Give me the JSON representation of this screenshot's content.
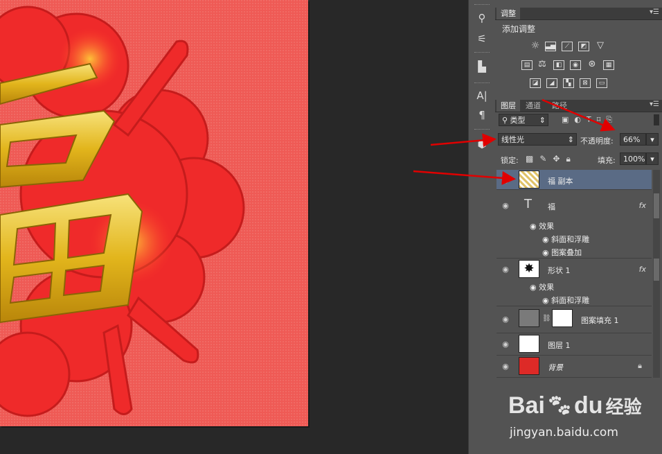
{
  "canvas_art": {
    "glyph_fragment": "福"
  },
  "adjustments_panel": {
    "tab": "调整",
    "title": "添加调整",
    "icons_row1": [
      "brightness-contrast-icon",
      "levels-icon",
      "curves-icon",
      "exposure-icon",
      "vibrance-icon"
    ],
    "icons_row2": [
      "hue-saturation-icon",
      "color-balance-icon",
      "black-white-icon",
      "photo-filter-icon",
      "channel-mixer-icon",
      "color-lookup-icon"
    ],
    "icons_row3": [
      "invert-icon",
      "posterize-icon",
      "threshold-icon",
      "selective-color-icon",
      "gradient-map-icon"
    ]
  },
  "layers_panel": {
    "tabs": [
      "图层",
      "通道",
      "路径"
    ],
    "filter_kind": "类型",
    "blend_mode": "线性光",
    "opacity_label": "不透明度:",
    "opacity_value": "66%",
    "lock_label": "锁定:",
    "fill_label": "填充:",
    "fill_value": "100%",
    "layers": [
      {
        "name": "福 副本",
        "selected": true
      },
      {
        "name": "福",
        "type": "text",
        "fx": "fx",
        "effects_label": "效果",
        "effects": [
          "斜面和浮雕",
          "图案叠加"
        ]
      },
      {
        "name": "形状 1",
        "type": "shape",
        "fx": "fx",
        "effects_label": "效果",
        "effects": [
          "斜面和浮雕"
        ]
      },
      {
        "name": "图案填充 1",
        "type": "pattern-fill"
      },
      {
        "name": "图层 1"
      },
      {
        "name": "背景",
        "locked": true
      }
    ]
  },
  "watermark": {
    "brand": "Bai",
    "brand2": "经验",
    "url": "jingyan.baidu.com"
  },
  "colors": {
    "canvas_red": "#f05a55",
    "gold": "#e8c22a",
    "selected_layer": "#5a6b85",
    "panel": "#535353",
    "arrow_red": "#e00000"
  }
}
